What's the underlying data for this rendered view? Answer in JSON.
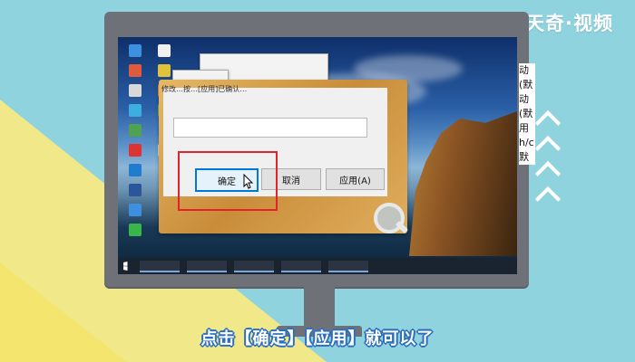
{
  "brand": {
    "text": "天奇·视频"
  },
  "dialog": {
    "top_text": "修改…按…[应用]已确认…",
    "buttons": {
      "ok": "确定",
      "cancel": "取消",
      "apply": "应用(A)"
    }
  },
  "side_strip": [
    "动(默",
    "动(默",
    "用",
    "h/c 默"
  ],
  "caption": {
    "text": "点击【确定】【应用】就可以了"
  },
  "colors": {
    "accent_blue": "#2d6fbf",
    "highlight_red": "#e1242c",
    "background_teal": "#8fd3df",
    "background_yellow": "#f1e889"
  },
  "icons": [
    "arrow-up-icon",
    "magnifier-icon",
    "mouse-cursor-icon",
    "windows-start-icon"
  ]
}
